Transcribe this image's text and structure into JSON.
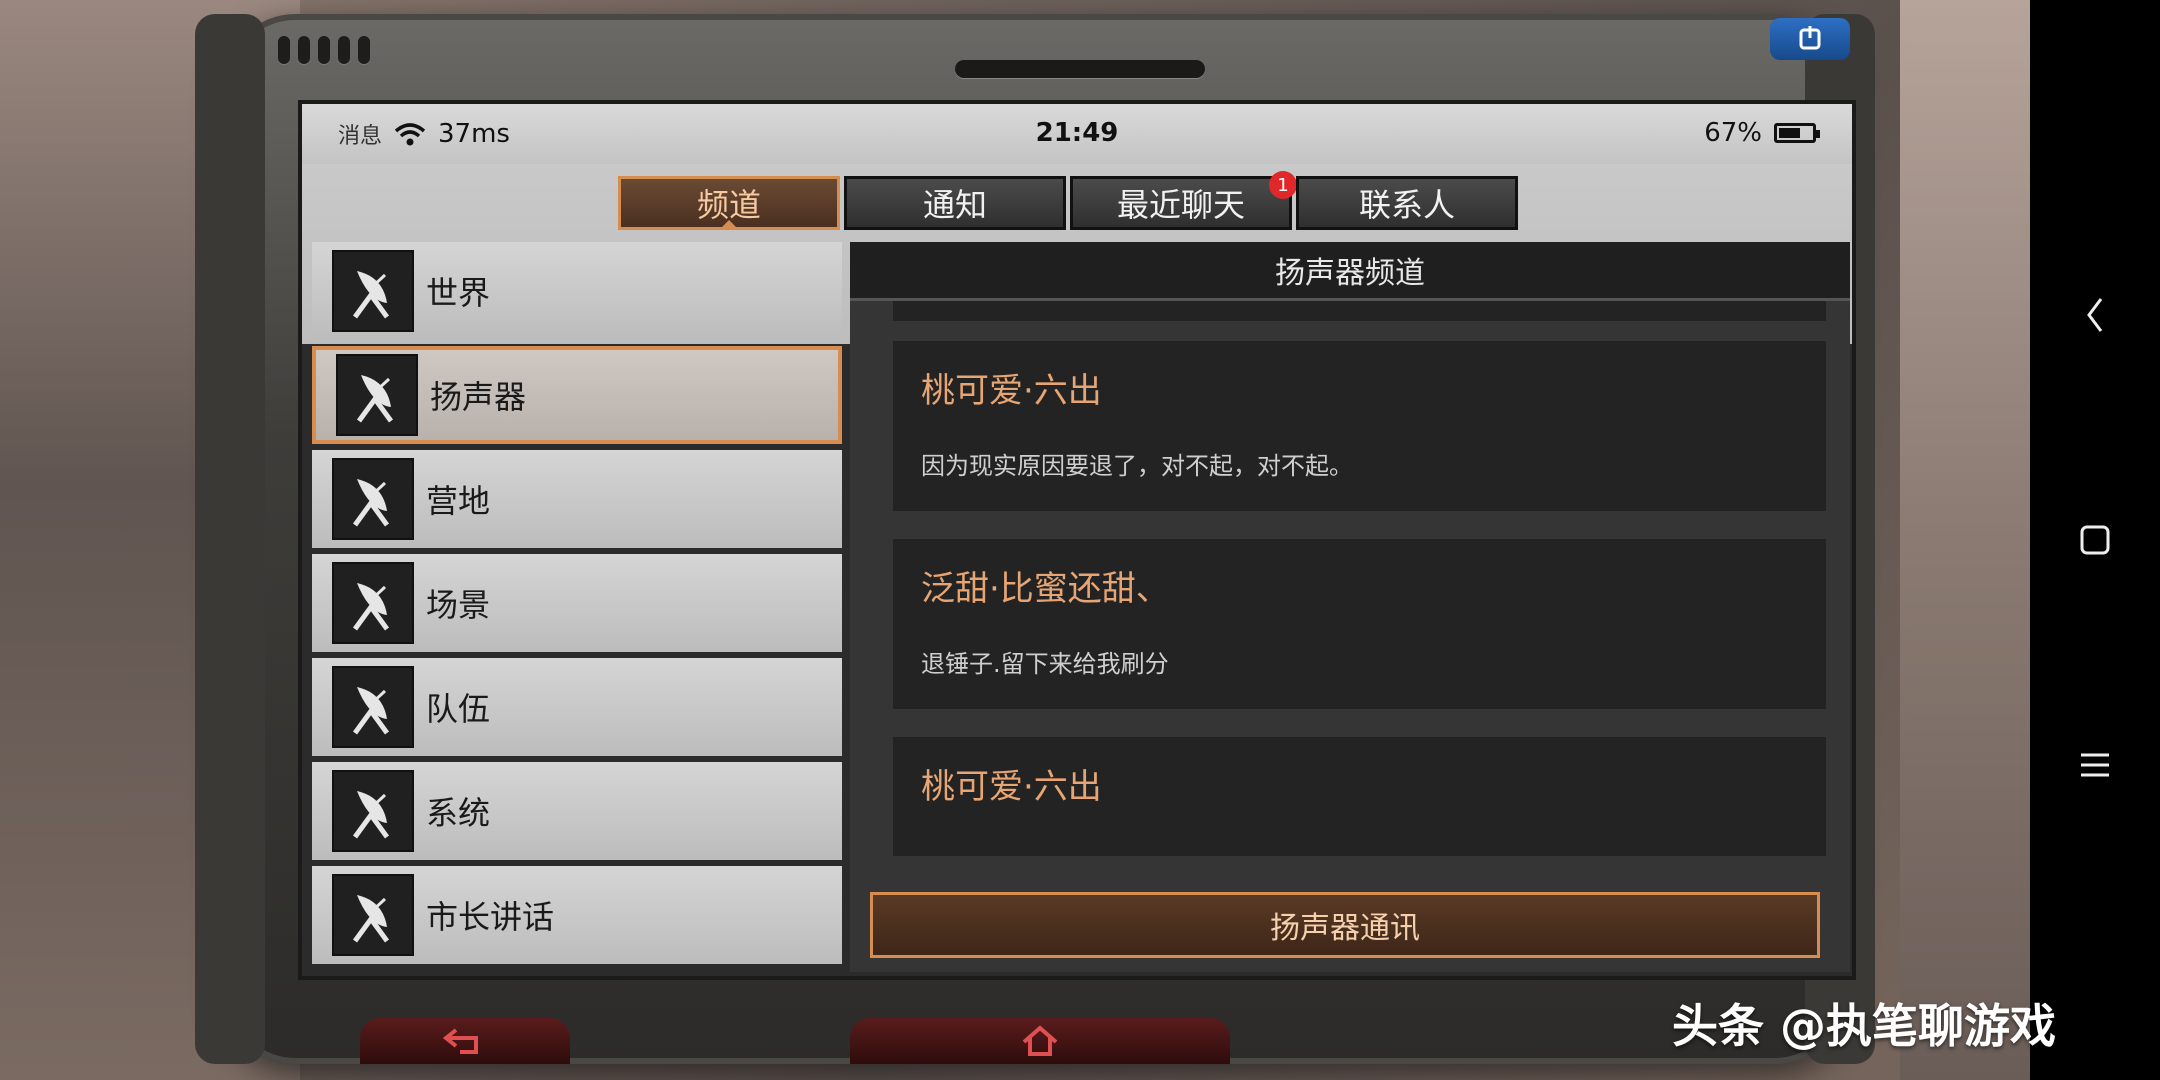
{
  "status": {
    "message": "消息",
    "ping": "37ms",
    "time": "21:49",
    "battery": "67%",
    "battery_level": 0.67
  },
  "tabs": [
    {
      "label": "频道",
      "active": true
    },
    {
      "label": "通知"
    },
    {
      "label": "最近聊天",
      "badge": "1"
    },
    {
      "label": "联系人"
    }
  ],
  "channels": [
    {
      "label": "世界",
      "icon": "radar-dish-icon"
    },
    {
      "label": "扬声器",
      "icon": "radar-dish-icon",
      "active": true
    },
    {
      "label": "营地",
      "icon": "radar-dish-icon"
    },
    {
      "label": "场景",
      "icon": "radar-dish-icon"
    },
    {
      "label": "队伍",
      "icon": "radar-dish-icon"
    },
    {
      "label": "系统",
      "icon": "radar-dish-icon"
    },
    {
      "label": "市长讲话",
      "icon": "radar-dish-icon"
    }
  ],
  "panel": {
    "title": "扬声器频道",
    "messages": [
      {
        "name": "桃可爱·六出",
        "text": "因为现实原因要退了，对不起，对不起。"
      },
      {
        "name": "泛甜·比蜜还甜、",
        "text": "退锤子.留下来给我刷分"
      },
      {
        "name": "桃可爱·六出",
        "text": ""
      }
    ],
    "button": "扬声器通讯"
  },
  "android_nav": {
    "back": "back-icon",
    "home": "square-home-icon",
    "menu": "menu-icon"
  },
  "watermark": "头条 @执笔聊游戏",
  "colors": {
    "accent": "#d78c50",
    "name": "#e6a572",
    "badge": "#e0282a"
  }
}
